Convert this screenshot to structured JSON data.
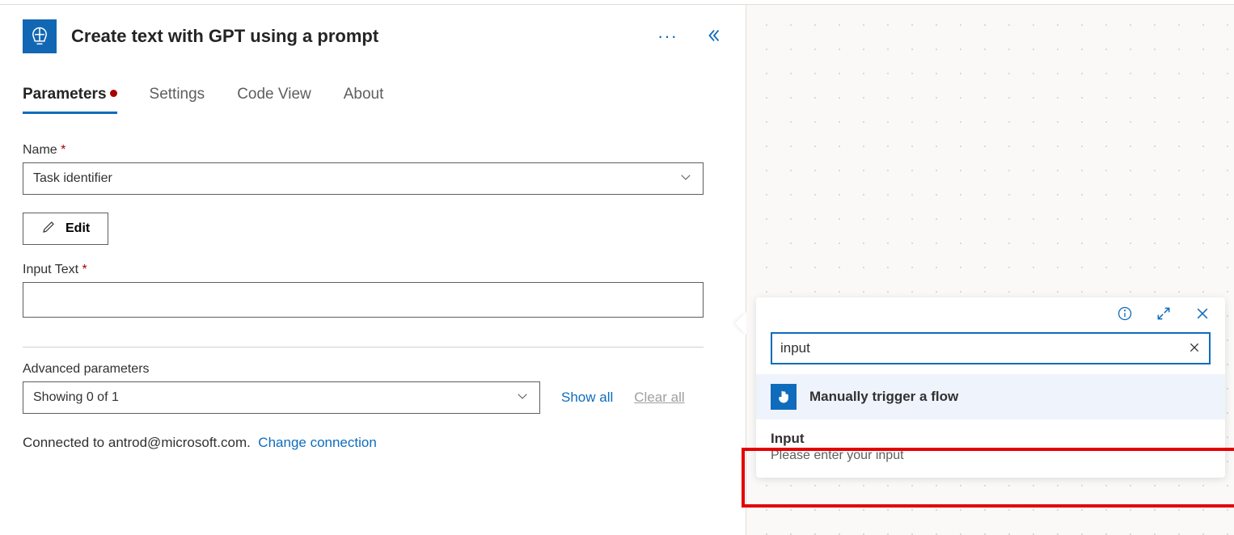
{
  "header": {
    "title": "Create text with GPT using a prompt"
  },
  "tabs": {
    "parameters": "Parameters",
    "settings": "Settings",
    "codeview": "Code View",
    "about": "About"
  },
  "fields": {
    "name_label": "Name",
    "name_value": "Task identifier",
    "edit_label": "Edit",
    "input_text_label": "Input Text",
    "advanced_label": "Advanced parameters",
    "advanced_value": "Showing 0 of 1",
    "show_all": "Show all",
    "clear_all": "Clear all"
  },
  "connection": {
    "prefix": "Connected to ",
    "email": "antrod@microsoft.com.",
    "change": "Change connection"
  },
  "flyout": {
    "search_value": "input",
    "trigger_title": "Manually trigger a flow",
    "result_title": "Input",
    "result_desc": "Please enter your input"
  }
}
